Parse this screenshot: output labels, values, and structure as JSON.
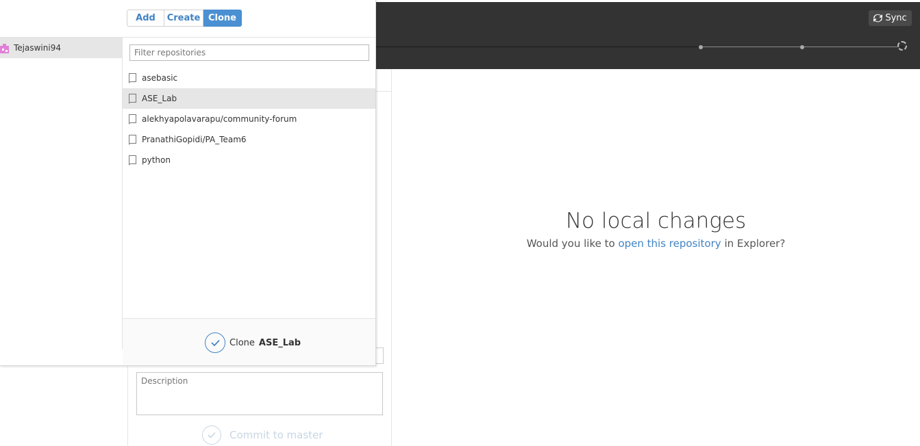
{
  "toolbar": {
    "sync_label": "Sync",
    "sync_icon": "sync-icon"
  },
  "popup": {
    "tabs": [
      {
        "label": "Add",
        "active": false
      },
      {
        "label": "Create",
        "active": false
      },
      {
        "label": "Clone",
        "active": true
      }
    ],
    "account": {
      "name": "Tejaswini94",
      "avatar_color": "#e27fd8"
    },
    "filter_placeholder": "Filter repositories",
    "repositories": [
      {
        "name": "asebasic",
        "selected": false
      },
      {
        "name": "ASE_Lab",
        "selected": true
      },
      {
        "name": "alekhyapolavarapu/community-forum",
        "selected": false
      },
      {
        "name": "PranathiGopidi/PA_Team6",
        "selected": false
      },
      {
        "name": "python",
        "selected": false
      }
    ],
    "clone_action": {
      "prefix": "Clone",
      "repo": "ASE_Lab"
    }
  },
  "main": {
    "empty_title": "No local changes",
    "empty_sub_before": "Would you like to",
    "empty_sub_link": "open this repository",
    "empty_sub_after": "in Explorer?"
  },
  "commit": {
    "description_placeholder": "Description",
    "commit_label": "Commit to master"
  },
  "colors": {
    "accent": "#4183c4",
    "topbar": "#333333",
    "tab_active": "#4a90d2"
  }
}
